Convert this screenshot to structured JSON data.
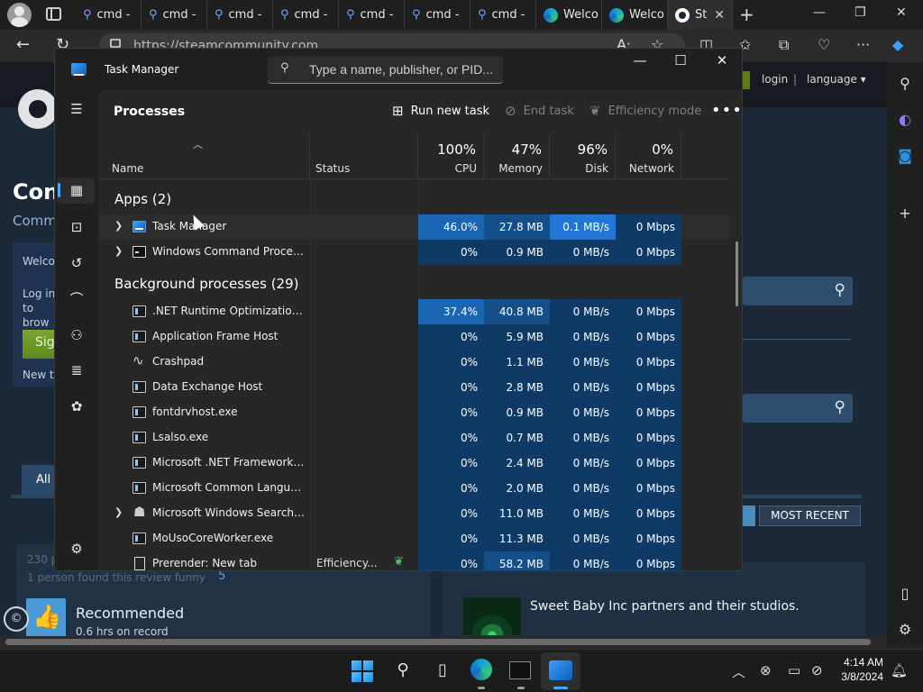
{
  "browser": {
    "tabs": [
      {
        "label": "cmd -",
        "kind": "search"
      },
      {
        "label": "cmd -",
        "kind": "search"
      },
      {
        "label": "cmd -",
        "kind": "search"
      },
      {
        "label": "cmd -",
        "kind": "search"
      },
      {
        "label": "cmd -",
        "kind": "search"
      },
      {
        "label": "cmd -",
        "kind": "search"
      },
      {
        "label": "cmd -",
        "kind": "search"
      },
      {
        "label": "Welco",
        "kind": "edge"
      },
      {
        "label": "Welco",
        "kind": "edge"
      },
      {
        "label": "St",
        "kind": "steam",
        "active": true
      }
    ],
    "address": "https://steamcommunity.com"
  },
  "steam": {
    "login": "login",
    "separator": "|",
    "language": "language ▾",
    "community_title": "Con",
    "community_sub": "Comm",
    "welcome": "Welco",
    "login_text": "Log in to brow",
    "sign_in": "Sig",
    "new_to": "New to",
    "all_tab": "All",
    "most_recent": "MOST RECENT",
    "review_count": "230 p",
    "funny_text": "1 person found this review funny",
    "funny_count": "5",
    "recommended": "Recommended",
    "hours": "0.6 hrs on record",
    "sbi_text": "Sweet Baby Inc partners and their studios.",
    "copyright_glyph": "©"
  },
  "taskmanager": {
    "title": "Task Manager",
    "search_placeholder": "Type a name, publisher, or PID...",
    "page_title": "Processes",
    "run_new_task": "Run new task",
    "end_task": "End task",
    "efficiency_mode": "Efficiency mode",
    "more": "•••",
    "columns": {
      "name": "Name",
      "status": "Status",
      "cpu_pct": "100%",
      "cpu": "CPU",
      "mem_pct": "47%",
      "mem": "Memory",
      "disk_pct": "96%",
      "disk": "Disk",
      "net_pct": "0%",
      "net": "Network"
    },
    "apps_group": "Apps (2)",
    "bg_group": "Background processes (29)",
    "apps": [
      {
        "name": "Task Manager",
        "icon": "tm",
        "expand": true,
        "status": "",
        "cpu": "46.0%",
        "mem": "27.8 MB",
        "disk": "0.1 MB/s",
        "net": "0 Mbps",
        "heat": [
          "h3",
          "h2",
          "h4",
          "h1"
        ]
      },
      {
        "name": "Windows Command Processor",
        "icon": "cmd",
        "expand": true,
        "status": "",
        "cpu": "0%",
        "mem": "0.9 MB",
        "disk": "0 MB/s",
        "net": "0 Mbps",
        "heat": [
          "h1",
          "h1",
          "h1",
          "h1"
        ]
      }
    ],
    "background": [
      {
        "name": ".NET Runtime Optimization Se...",
        "icon": "app",
        "cpu": "37.4%",
        "mem": "40.8 MB",
        "disk": "0 MB/s",
        "net": "0 Mbps",
        "heat": [
          "h3",
          "h2",
          "h1",
          "h1"
        ]
      },
      {
        "name": "Application Frame Host",
        "icon": "app",
        "cpu": "0%",
        "mem": "5.9 MB",
        "disk": "0 MB/s",
        "net": "0 Mbps",
        "heat": [
          "h1",
          "h1",
          "h1",
          "h1"
        ]
      },
      {
        "name": "Crashpad",
        "icon": "pulse",
        "cpu": "0%",
        "mem": "1.1 MB",
        "disk": "0 MB/s",
        "net": "0 Mbps",
        "heat": [
          "h1",
          "h1",
          "h1",
          "h1"
        ]
      },
      {
        "name": "Data Exchange Host",
        "icon": "app",
        "cpu": "0%",
        "mem": "2.8 MB",
        "disk": "0 MB/s",
        "net": "0 Mbps",
        "heat": [
          "h1",
          "h1",
          "h1",
          "h1"
        ]
      },
      {
        "name": "fontdrvhost.exe",
        "icon": "app",
        "cpu": "0%",
        "mem": "0.9 MB",
        "disk": "0 MB/s",
        "net": "0 Mbps",
        "heat": [
          "h1",
          "h1",
          "h1",
          "h1"
        ]
      },
      {
        "name": "Lsalso.exe",
        "icon": "app",
        "cpu": "0%",
        "mem": "0.7 MB",
        "disk": "0 MB/s",
        "net": "0 Mbps",
        "heat": [
          "h1",
          "h1",
          "h1",
          "h1"
        ]
      },
      {
        "name": "Microsoft .NET Framework op...",
        "icon": "app",
        "cpu": "0%",
        "mem": "2.4 MB",
        "disk": "0 MB/s",
        "net": "0 Mbps",
        "heat": [
          "h1",
          "h1",
          "h1",
          "h1"
        ]
      },
      {
        "name": "Microsoft Common Language...",
        "icon": "app",
        "cpu": "0%",
        "mem": "2.0 MB",
        "disk": "0 MB/s",
        "net": "0 Mbps",
        "heat": [
          "h1",
          "h1",
          "h1",
          "h1"
        ]
      },
      {
        "name": "Microsoft Windows Search In...",
        "icon": "person",
        "expand": true,
        "cpu": "0%",
        "mem": "11.0 MB",
        "disk": "0 MB/s",
        "net": "0 Mbps",
        "heat": [
          "h1",
          "h1",
          "h1",
          "h1"
        ]
      },
      {
        "name": "MoUsoCoreWorker.exe",
        "icon": "app",
        "cpu": "0%",
        "mem": "11.3 MB",
        "disk": "0 MB/s",
        "net": "0 Mbps",
        "heat": [
          "h1",
          "h1",
          "h1",
          "h1"
        ]
      },
      {
        "name": "Prerender: New tab",
        "icon": "doc",
        "status": "Efficiency...",
        "leaf": true,
        "cpu": "0%",
        "mem": "58.2 MB",
        "disk": "0 MB/s",
        "net": "0 Mbps",
        "heat": [
          "h1",
          "h2",
          "h1",
          "h1"
        ]
      }
    ]
  },
  "taskbar": {
    "time": "4:14 AM",
    "date": "3/8/2024"
  }
}
